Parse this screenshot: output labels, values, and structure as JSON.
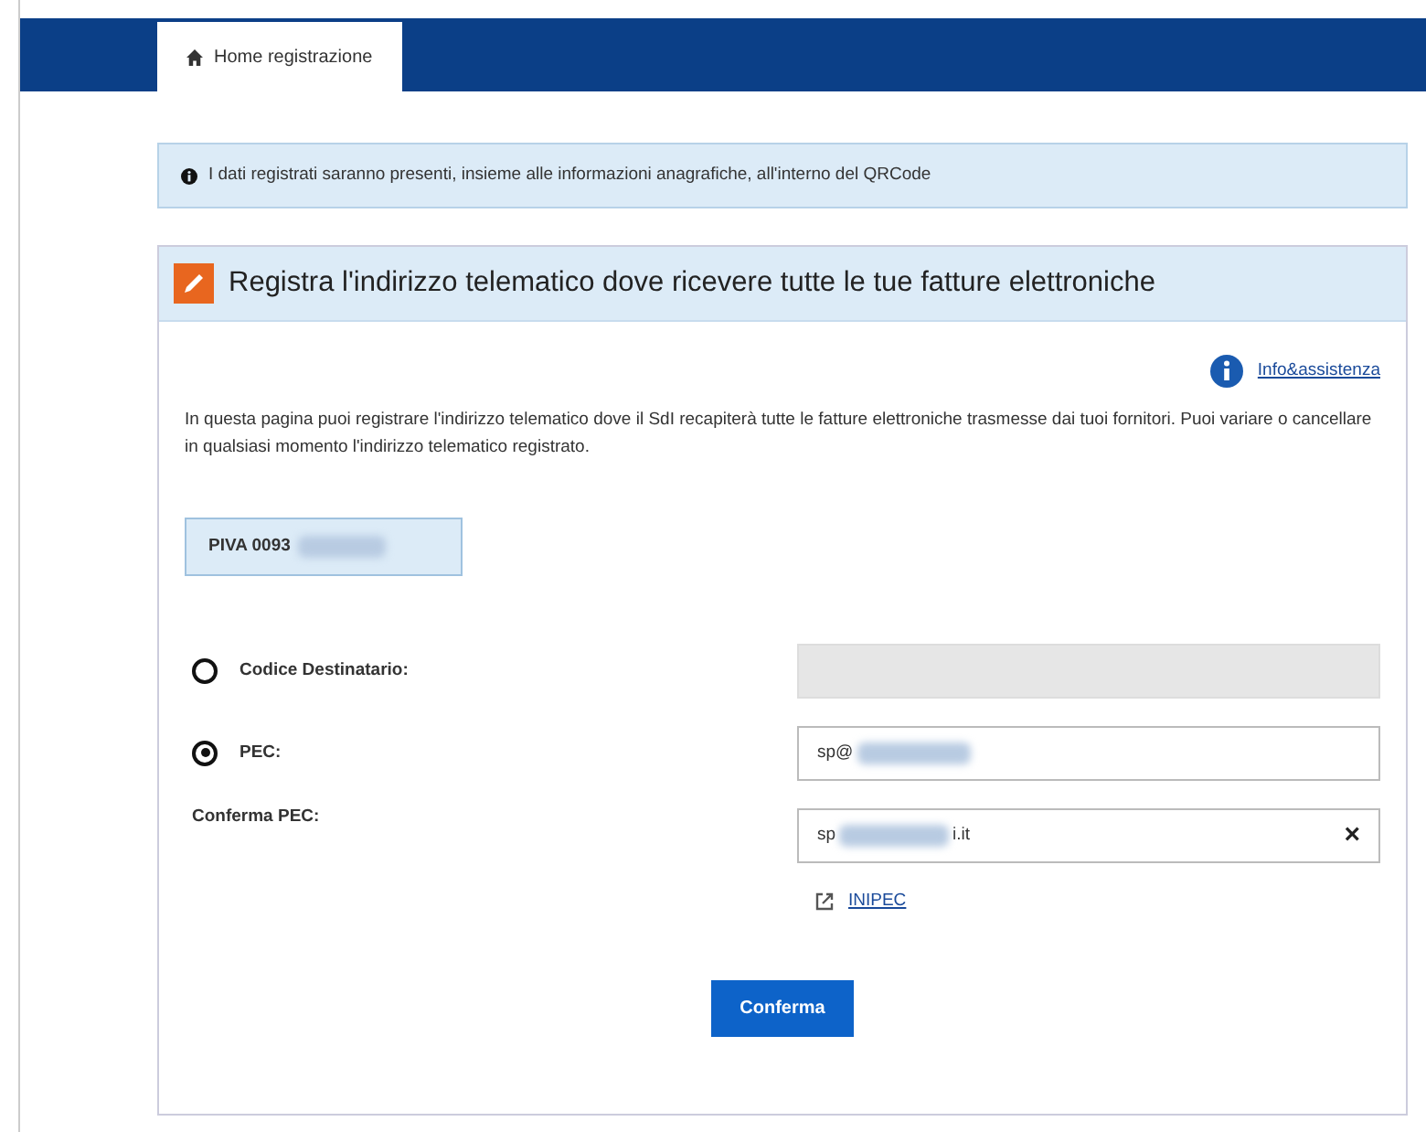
{
  "tabs": [
    {
      "label": "Home registrazione",
      "selected": true
    }
  ],
  "alert": {
    "text": "I dati registrati saranno presenti, insieme alle informazioni anagrafiche, all'interno del QRCode"
  },
  "card": {
    "title": "Registra l'indirizzo telematico dove ricevere tutte le tue fatture elettroniche",
    "help_link": "Info&assistenza",
    "description": "In questa pagina puoi registrare l'indirizzo telematico dove il SdI recapiterà tutte le fatture elettroniche trasmesse dai tuoi fornitori. Puoi variare o cancellare in qualsiasi momento l'indirizzo telematico registrato.",
    "vat_box": {
      "text": "PIVA 0093",
      "redacted": true
    },
    "rows": [
      {
        "kind": "radio",
        "label": "Codice Destinatario:",
        "selected": false,
        "field": {
          "disabled": true
        }
      },
      {
        "kind": "radio",
        "label": "PEC:",
        "selected": true,
        "field": {
          "disabled": false,
          "value": "sp@",
          "redacted": true
        }
      },
      {
        "kind": "plain",
        "label": "Conferma PEC:",
        "field": {
          "disabled": false,
          "value": "sp",
          "redacted": true,
          "value_end": "i.it",
          "clear": "×"
        }
      }
    ],
    "external_link": "INIPEC",
    "submit": "Conferma"
  }
}
